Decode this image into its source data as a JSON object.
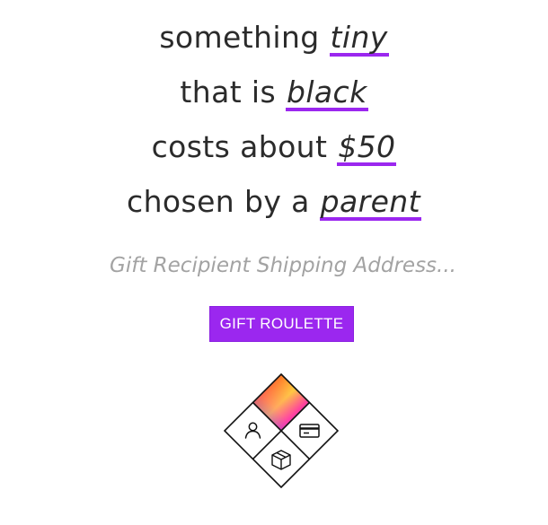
{
  "sentence": {
    "line1": {
      "prefix": "something ",
      "choice": "tiny"
    },
    "line2": {
      "prefix": "that is ",
      "choice": "black"
    },
    "line3": {
      "prefix": "costs about ",
      "choice": "$50"
    },
    "line4": {
      "prefix": "chosen by a ",
      "choice": "parent"
    }
  },
  "address": {
    "placeholder": "Gift Recipient Shipping Address...",
    "value": ""
  },
  "button": {
    "label": "GIFT ROULETTE"
  },
  "colors": {
    "accent": "#9b27ef",
    "text": "#2b2b2b",
    "placeholder": "#a3a3a3"
  },
  "logo": {
    "icons": [
      "rainbow-gradient",
      "user-icon",
      "credit-card-icon",
      "package-box-icon"
    ]
  }
}
